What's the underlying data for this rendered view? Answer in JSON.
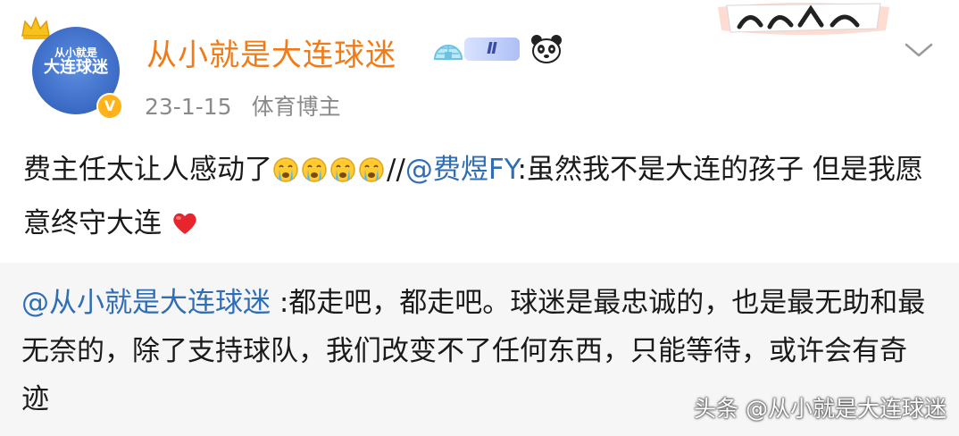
{
  "post": {
    "author": {
      "name": "从小就是大连球迷",
      "avatar_text_line1": "从小就是",
      "avatar_text_line2": "大连球迷",
      "verified_mark": "V",
      "level": "Ⅱ"
    },
    "meta": {
      "date": "23-1-15",
      "tag": "体育博主"
    },
    "content": {
      "part1": "费主任太让人感动了",
      "emoji_icons": [
        "crying-face-icon",
        "crying-face-icon",
        "crying-face-icon",
        "crying-face-icon"
      ],
      "repost_sep": "//",
      "mention": "@费煜FY",
      "part2": ":虽然我不是大连的孩子 但是我愿意终守大连",
      "heart_icon": "red-heart-icon"
    }
  },
  "quote": {
    "mention": "@从小就是大连球迷",
    "text": " :都走吧，都走吧。球迷是最忠诚的，也是最无助和最无奈的，除了支持球队，我们改变不了任何东西，只能等待，或许会有奇迹"
  },
  "watermark": "头条 @从小就是大连球迷",
  "colors": {
    "username": "#f07b17",
    "mention": "#2f6db5",
    "meta": "#8a8a8a",
    "quote_bg": "#f6f6f6"
  }
}
